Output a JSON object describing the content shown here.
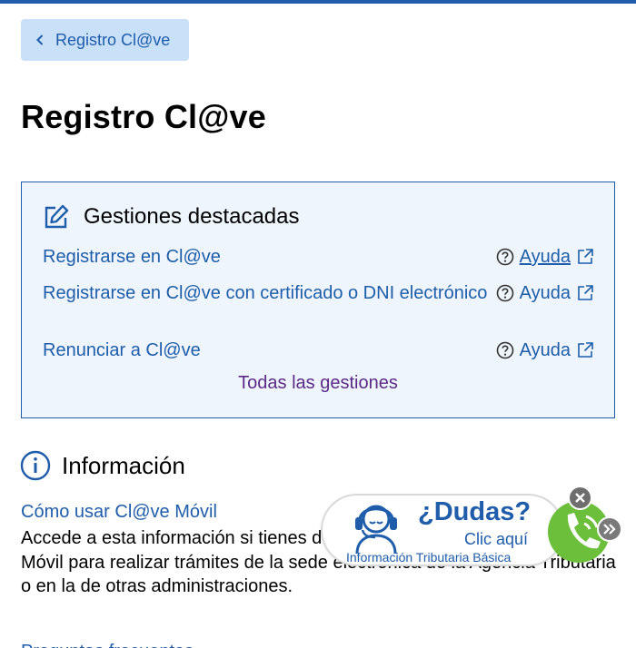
{
  "header": {
    "back_label": "Registro Cl@ve"
  },
  "page": {
    "title": "Registro Cl@ve"
  },
  "featured": {
    "title": "Gestiones destacadas",
    "items": [
      {
        "label": "Registrarse en Cl@ve",
        "help": "Ayuda"
      },
      {
        "label": "Registrarse en Cl@ve con certificado o DNI electrónico",
        "help": "Ayuda"
      },
      {
        "label": "Renunciar a Cl@ve",
        "help": "Ayuda"
      }
    ],
    "all_link": "Todas las gestiones"
  },
  "info": {
    "title": "Información",
    "link": "Cómo usar Cl@ve Móvil",
    "text": "Accede a esta información si tienes dudas acerca de cómo usar Cl@ve Móvil para realizar trámites de la sede electrónica de la Agencia Tributaria o en la de otras administraciones.",
    "next_link": "Preguntas frecuentes"
  },
  "widget": {
    "title": "¿Dudas?",
    "click": "Clic aquí",
    "subtitle": "Información Tributaria Básica"
  },
  "colors": {
    "primary": "#1f5dab",
    "panel_bg": "#eef5fc",
    "back_bg": "#c8e0f8",
    "visited": "#5b2a86",
    "phone_green": "#6cbf3a"
  },
  "icons": [
    "chevron-left-icon",
    "edit-icon",
    "help-circle-icon",
    "external-link-icon",
    "info-icon",
    "agent-headset-icon",
    "phone-icon",
    "close-icon",
    "chevron-right-icon"
  ]
}
